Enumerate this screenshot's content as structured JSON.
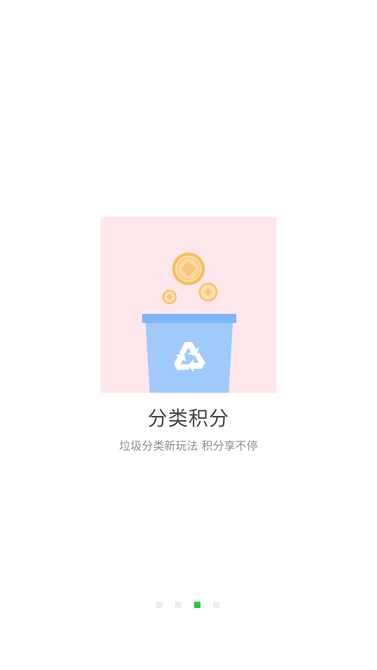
{
  "onboarding": {
    "title": "分类积分",
    "subtitle": "垃圾分类新玩法 积分享不停",
    "illustration_icon": "recycle-bin-with-coins",
    "page_count": 4,
    "current_page": 3
  },
  "colors": {
    "illustration_bg": "#fde7ea",
    "bin_body": "#a0c9fc",
    "bin_rim": "#7fb6f7",
    "coin_ring": "#f7bc5a",
    "coin_fill": "#fdd9a0",
    "active_dot": "#1fcf3f",
    "inactive_dot": "#ececec"
  }
}
